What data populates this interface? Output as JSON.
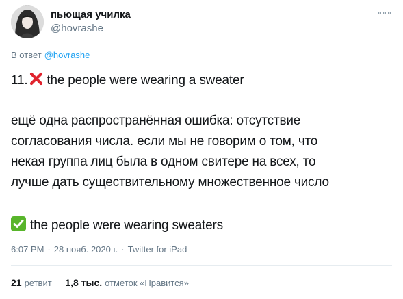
{
  "author": {
    "display_name": "пьющая училка",
    "handle": "@hovrashe"
  },
  "reply": {
    "prefix": "В ответ",
    "target": "@hovrashe"
  },
  "tweet": {
    "line1_number": "11.",
    "line1_text": "the people were wearing a sweater",
    "para2": [
      "ещё одна распространённая ошибка: отсутствие",
      "согласования числа. если мы не говорим о том, что",
      "некая группа лиц была в одном свитере на всех, то",
      "лучше дать существительному множественное число"
    ],
    "correct_text": "the people were wearing sweaters"
  },
  "meta": {
    "time": "6:07 PM",
    "date": "28 нояб. 2020 г.",
    "source": "Twitter for iPad"
  },
  "stats": {
    "retweets_count": "21",
    "retweets_label": "ретвит",
    "likes_count": "1,8 тыс.",
    "likes_label": "отметок «Нравится»"
  },
  "icons": {
    "wrong": "cross-mark-icon",
    "right": "check-mark-icon",
    "more": "more-options-icon"
  },
  "colors": {
    "link": "#1da1f2",
    "secondary_text": "#657786",
    "cross": "#e0242e",
    "check_bg": "#58b52b"
  }
}
